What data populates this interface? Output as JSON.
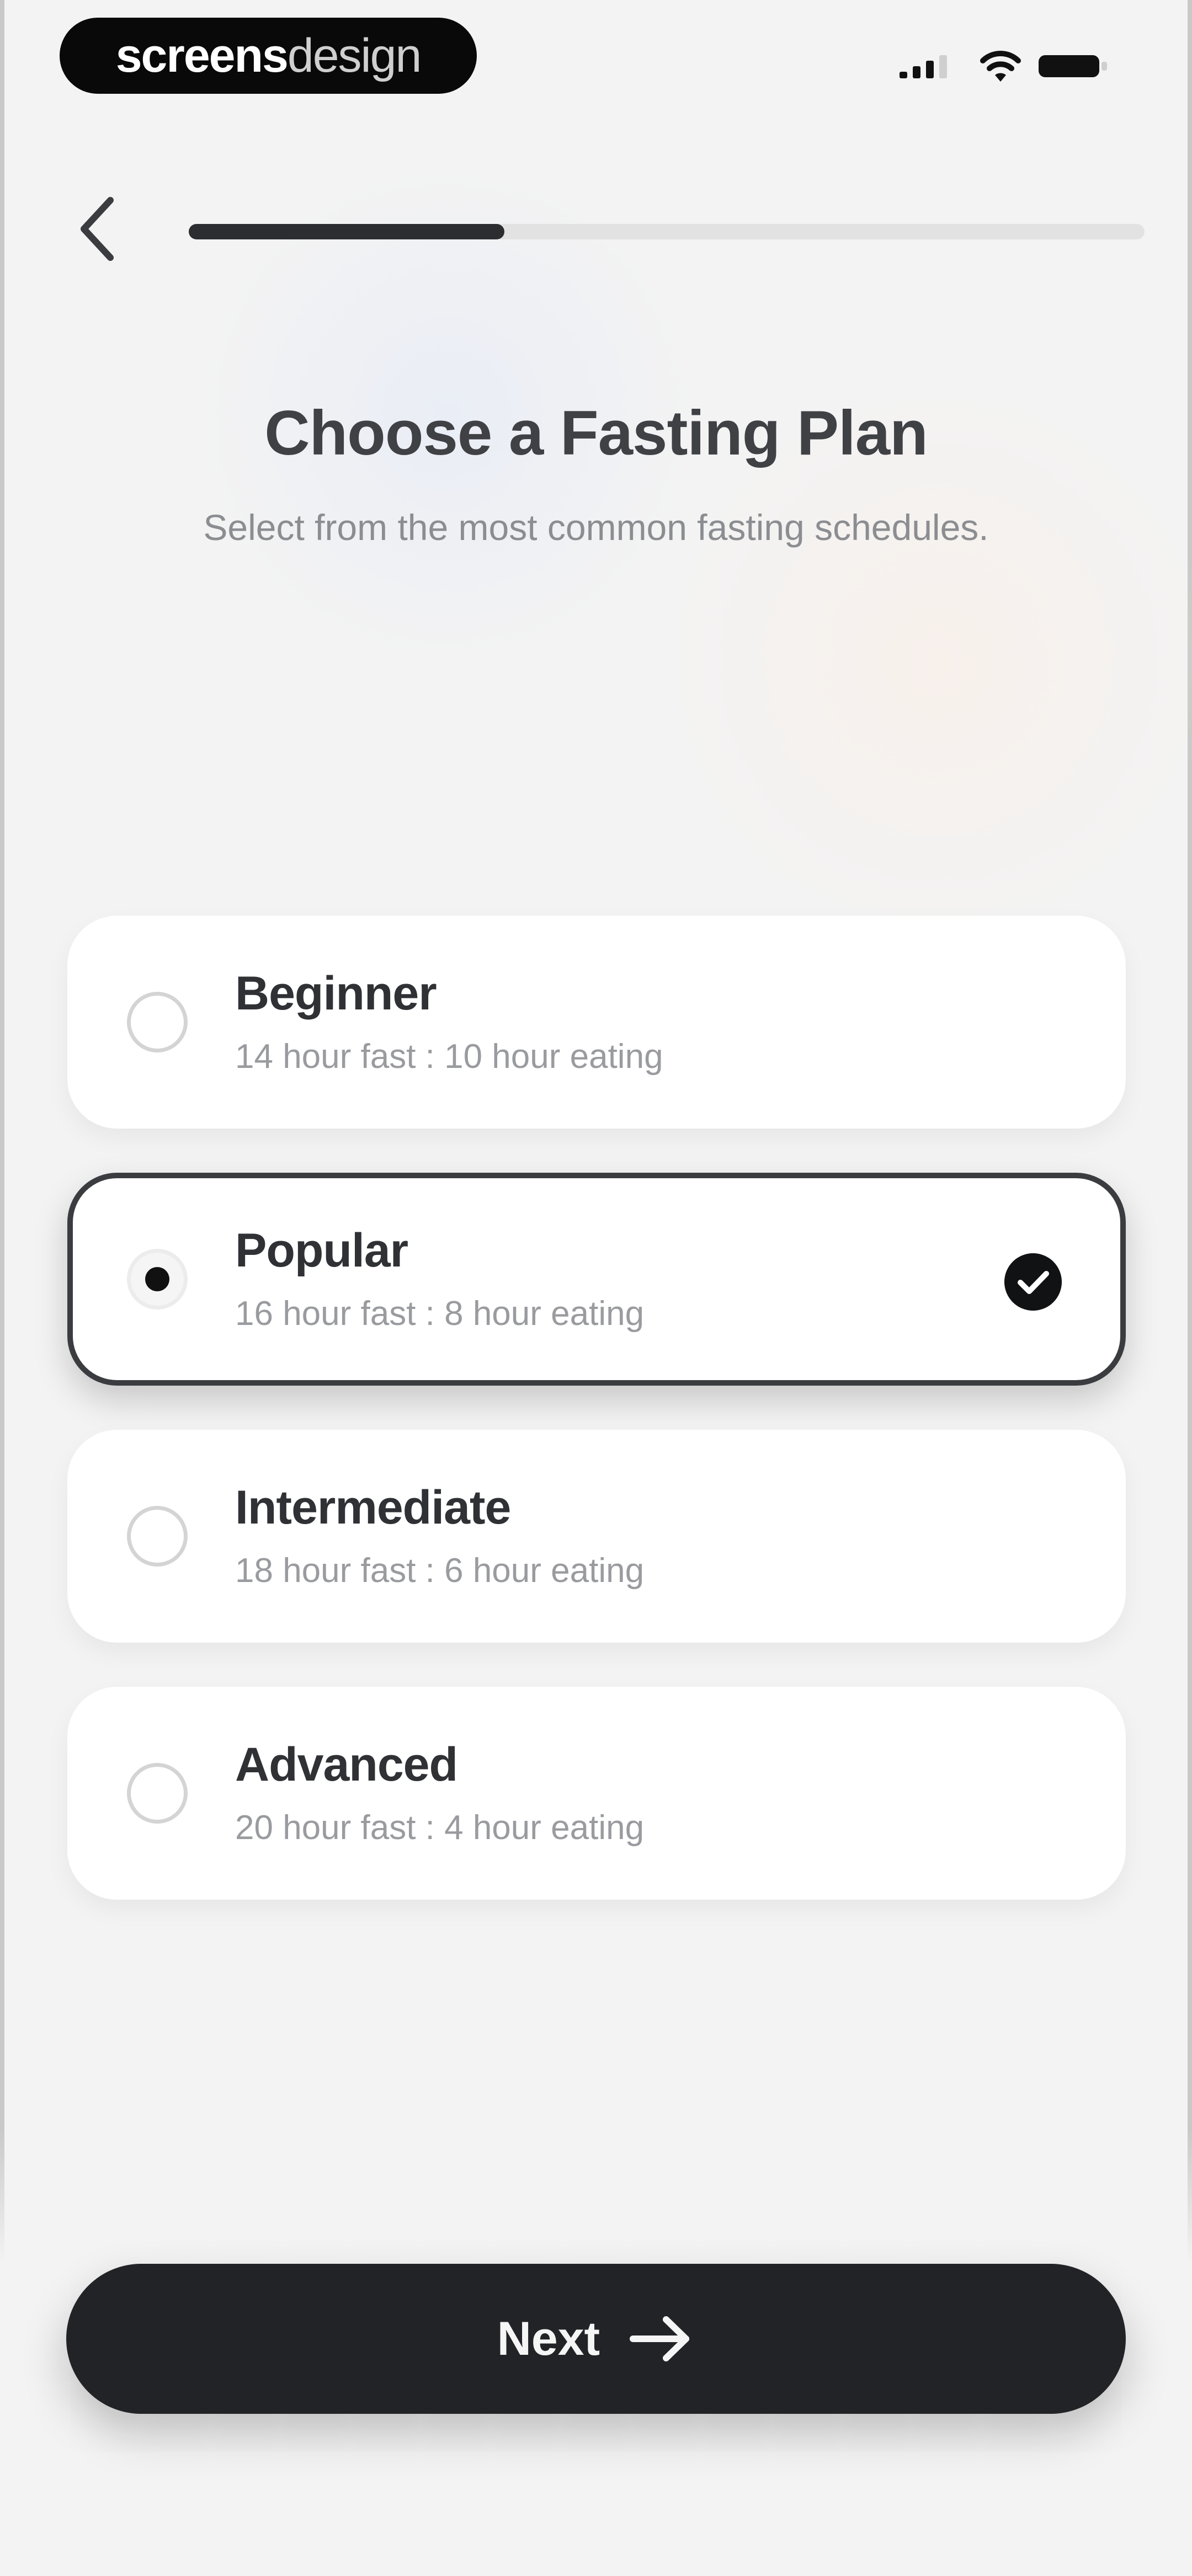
{
  "status_bar": {
    "brand_part_1": "screens",
    "brand_part_2": "design",
    "icons": [
      "cellular-signal-icon",
      "wifi-icon",
      "battery-icon"
    ]
  },
  "header": {
    "back_icon": "chevron-left-icon",
    "progress_fraction": 0.33
  },
  "content": {
    "title": "Choose a Fasting Plan",
    "subtitle": "Select from the most common fasting schedules."
  },
  "plans": [
    {
      "name": "Beginner",
      "description": "14 hour fast : 10 hour eating",
      "selected": false
    },
    {
      "name": "Popular",
      "description": "16 hour fast : 8 hour eating",
      "selected": true,
      "selected_icon": "check-circle-icon"
    },
    {
      "name": "Intermediate",
      "description": "18 hour fast : 6 hour eating",
      "selected": false
    },
    {
      "name": "Advanced",
      "description": "20 hour fast : 4 hour eating",
      "selected": false
    }
  ],
  "footer": {
    "next_label": "Next",
    "next_icon": "arrow-right-icon"
  },
  "colors": {
    "background": "#f3f3f3",
    "primary": "#222326",
    "card": "#ffffff",
    "progress_track": "#e2e2e2",
    "muted_text": "#9a9b9f"
  }
}
